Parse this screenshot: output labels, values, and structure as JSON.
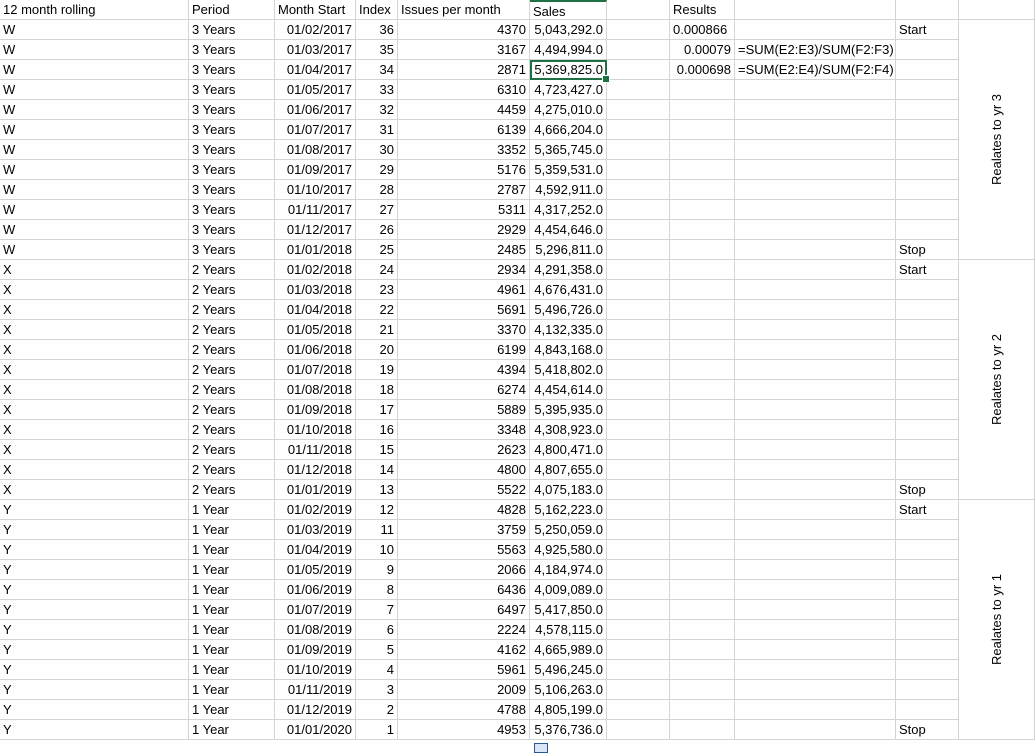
{
  "headers": {
    "rolling": "12 month rolling",
    "period": "Period",
    "month_start": "Month Start",
    "index": "Index",
    "issues": "Issues per month",
    "sales": "Sales",
    "results": "Results"
  },
  "rows": [
    [
      "W",
      "3 Years",
      "01/02/2017",
      "36",
      "4370",
      "5,043,292.0"
    ],
    [
      "W",
      "3 Years",
      "01/03/2017",
      "35",
      "3167",
      "4,494,994.0"
    ],
    [
      "W",
      "3 Years",
      "01/04/2017",
      "34",
      "2871",
      "5,369,825.0"
    ],
    [
      "W",
      "3 Years",
      "01/05/2017",
      "33",
      "6310",
      "4,723,427.0"
    ],
    [
      "W",
      "3 Years",
      "01/06/2017",
      "32",
      "4459",
      "4,275,010.0"
    ],
    [
      "W",
      "3 Years",
      "01/07/2017",
      "31",
      "6139",
      "4,666,204.0"
    ],
    [
      "W",
      "3 Years",
      "01/08/2017",
      "30",
      "3352",
      "5,365,745.0"
    ],
    [
      "W",
      "3 Years",
      "01/09/2017",
      "29",
      "5176",
      "5,359,531.0"
    ],
    [
      "W",
      "3 Years",
      "01/10/2017",
      "28",
      "2787",
      "4,592,911.0"
    ],
    [
      "W",
      "3 Years",
      "01/11/2017",
      "27",
      "5311",
      "4,317,252.0"
    ],
    [
      "W",
      "3 Years",
      "01/12/2017",
      "26",
      "2929",
      "4,454,646.0"
    ],
    [
      "W",
      "3 Years",
      "01/01/2018",
      "25",
      "2485",
      "5,296,811.0"
    ],
    [
      "X",
      "2 Years",
      "01/02/2018",
      "24",
      "2934",
      "4,291,358.0"
    ],
    [
      "X",
      "2 Years",
      "01/03/2018",
      "23",
      "4961",
      "4,676,431.0"
    ],
    [
      "X",
      "2 Years",
      "01/04/2018",
      "22",
      "5691",
      "5,496,726.0"
    ],
    [
      "X",
      "2 Years",
      "01/05/2018",
      "21",
      "3370",
      "4,132,335.0"
    ],
    [
      "X",
      "2 Years",
      "01/06/2018",
      "20",
      "6199",
      "4,843,168.0"
    ],
    [
      "X",
      "2 Years",
      "01/07/2018",
      "19",
      "4394",
      "5,418,802.0"
    ],
    [
      "X",
      "2 Years",
      "01/08/2018",
      "18",
      "6274",
      "4,454,614.0"
    ],
    [
      "X",
      "2 Years",
      "01/09/2018",
      "17",
      "5889",
      "5,395,935.0"
    ],
    [
      "X",
      "2 Years",
      "01/10/2018",
      "16",
      "3348",
      "4,308,923.0"
    ],
    [
      "X",
      "2 Years",
      "01/11/2018",
      "15",
      "2623",
      "4,800,471.0"
    ],
    [
      "X",
      "2 Years",
      "01/12/2018",
      "14",
      "4800",
      "4,807,655.0"
    ],
    [
      "X",
      "2 Years",
      "01/01/2019",
      "13",
      "5522",
      "4,075,183.0"
    ],
    [
      "Y",
      "1 Year",
      "01/02/2019",
      "12",
      "4828",
      "5,162,223.0"
    ],
    [
      "Y",
      "1 Year",
      "01/03/2019",
      "11",
      "3759",
      "5,250,059.0"
    ],
    [
      "Y",
      "1 Year",
      "01/04/2019",
      "10",
      "5563",
      "4,925,580.0"
    ],
    [
      "Y",
      "1 Year",
      "01/05/2019",
      "9",
      "2066",
      "4,184,974.0"
    ],
    [
      "Y",
      "1 Year",
      "01/06/2019",
      "8",
      "6436",
      "4,009,089.0"
    ],
    [
      "Y",
      "1 Year",
      "01/07/2019",
      "7",
      "6497",
      "5,417,850.0"
    ],
    [
      "Y",
      "1 Year",
      "01/08/2019",
      "6",
      "2224",
      "4,578,115.0"
    ],
    [
      "Y",
      "1 Year",
      "01/09/2019",
      "5",
      "4162",
      "4,665,989.0"
    ],
    [
      "Y",
      "1 Year",
      "01/10/2019",
      "4",
      "5961",
      "5,496,245.0"
    ],
    [
      "Y",
      "1 Year",
      "01/11/2019",
      "3",
      "2009",
      "5,106,263.0"
    ],
    [
      "Y",
      "1 Year",
      "01/12/2019",
      "2",
      "4788",
      "4,805,199.0"
    ],
    [
      "Y",
      "1 Year",
      "01/01/2020",
      "1",
      "4953",
      "5,376,736.0"
    ]
  ],
  "results": [
    {
      "value": "0.000866",
      "formula": ""
    },
    {
      "value": "0.00079",
      "formula": "=SUM(E2:E3)/SUM(F2:F3)"
    },
    {
      "value": "0.000698",
      "formula": "=SUM(E2:E4)/SUM(F2:F4)"
    }
  ],
  "markers": {
    "1": "Start",
    "12": "Stop",
    "13": "Start",
    "24": "Stop",
    "25": "Start",
    "36": "Stop"
  },
  "group_labels": {
    "yr3": "Realates to yr 3",
    "yr2": "Realates to yr 2",
    "yr1": "Realates to yr 1"
  },
  "selected_cell": "F4",
  "accent_color": "#1e7145"
}
